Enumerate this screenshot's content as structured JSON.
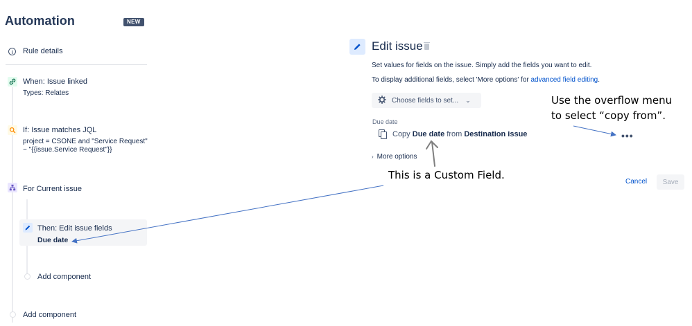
{
  "sidebar": {
    "title": "Automation",
    "badge": "NEW",
    "rule_details": "Rule details",
    "when": {
      "title": "When: Issue linked",
      "sub": "Types: Relates"
    },
    "if": {
      "title": "If: Issue matches JQL",
      "sub1": "project = CSONE and \"Service Request\"",
      "sub2": "~ \"{{issue.Service Request\"}}"
    },
    "for": {
      "title": "For Current issue"
    },
    "then": {
      "title": "Then: Edit issue fields",
      "sub": "Due date"
    },
    "add_component_inner": "Add component",
    "add_component_outer": "Add component"
  },
  "edit_panel": {
    "title": "Edit issue",
    "desc_line1": "Set values for fields on the issue. Simply add the fields you want to edit.",
    "desc_line2_prefix": "To display additional fields, select 'More options' for ",
    "desc_line2_link": "advanced field editing",
    "desc_line2_suffix": ".",
    "choose_fields": "Choose fields to set...",
    "field_label": "Due date",
    "copy_word": "Copy",
    "copy_field": "Due date",
    "copy_from_word": "from",
    "copy_source": "Destination issue",
    "more_options": "More options",
    "overflow": "•••",
    "cancel": "Cancel",
    "save": "Save"
  },
  "annotations": {
    "overflow_line1": "Use the overflow menu",
    "overflow_line2": "to select “copy from”.",
    "custom_field": "This is a Custom Field."
  },
  "colors": {
    "link": "#0052cc",
    "when_icon_bg": "#e3fcef",
    "if_icon_bg": "#fffae6",
    "for_icon_bg": "#eae6ff",
    "then_icon_bg": "#deebff",
    "annotation_arrow": "#4472c4"
  }
}
